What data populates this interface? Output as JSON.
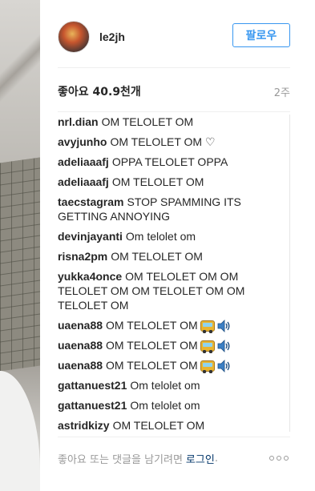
{
  "post": {
    "username": "le2jh",
    "follow_label": "팔로우",
    "likes_text": "좋아요 40.9천개",
    "age_text": "2주",
    "comments": [
      {
        "author": "nrl.dian",
        "text": "OM TELOLET OM",
        "emoji": ""
      },
      {
        "author": "avyjunho",
        "text": "OM TELOLET OM ♡",
        "emoji": ""
      },
      {
        "author": "adeliaaafj",
        "text": "OPPA TELOLET OPPA",
        "emoji": ""
      },
      {
        "author": "adeliaaafj",
        "text": "OM TELOLET OM",
        "emoji": ""
      },
      {
        "author": "taecstagram",
        "text": "STOP SPAMMING ITS GETTING ANNOYING",
        "emoji": ""
      },
      {
        "author": "devinjayanti",
        "text": "Om telolet om",
        "emoji": ""
      },
      {
        "author": "risna2pm",
        "text": "OM TELOLET OM",
        "emoji": ""
      },
      {
        "author": "yukka4once",
        "text": "OM TELOLET OM OM TELOLET OM OM TELOLET OM OM TELOLET OM",
        "emoji": ""
      },
      {
        "author": "uaena88",
        "text": "OM TELOLET OM",
        "emoji": "bus-speaker"
      },
      {
        "author": "uaena88",
        "text": "OM TELOLET OM",
        "emoji": "bus-speaker"
      },
      {
        "author": "uaena88",
        "text": "OM TELOLET OM",
        "emoji": "bus-speaker"
      },
      {
        "author": "gattanuest21",
        "text": "Om telolet om",
        "emoji": ""
      },
      {
        "author": "gattanuest21",
        "text": "Om telolet om",
        "emoji": ""
      },
      {
        "author": "astridkizy",
        "text": "OM TELOLET OM",
        "emoji": ""
      }
    ]
  },
  "footer": {
    "prompt_text": "좋아요 또는 댓글을 남기려면",
    "login_link": "로그인",
    "period": "."
  },
  "colors": {
    "accent": "#3897f0",
    "link": "#003569",
    "muted": "#999999",
    "text": "#262626"
  },
  "icons": {
    "more": "more-options-icon",
    "bus": "bus-emoji-icon",
    "speaker": "speaker-emoji-icon"
  }
}
